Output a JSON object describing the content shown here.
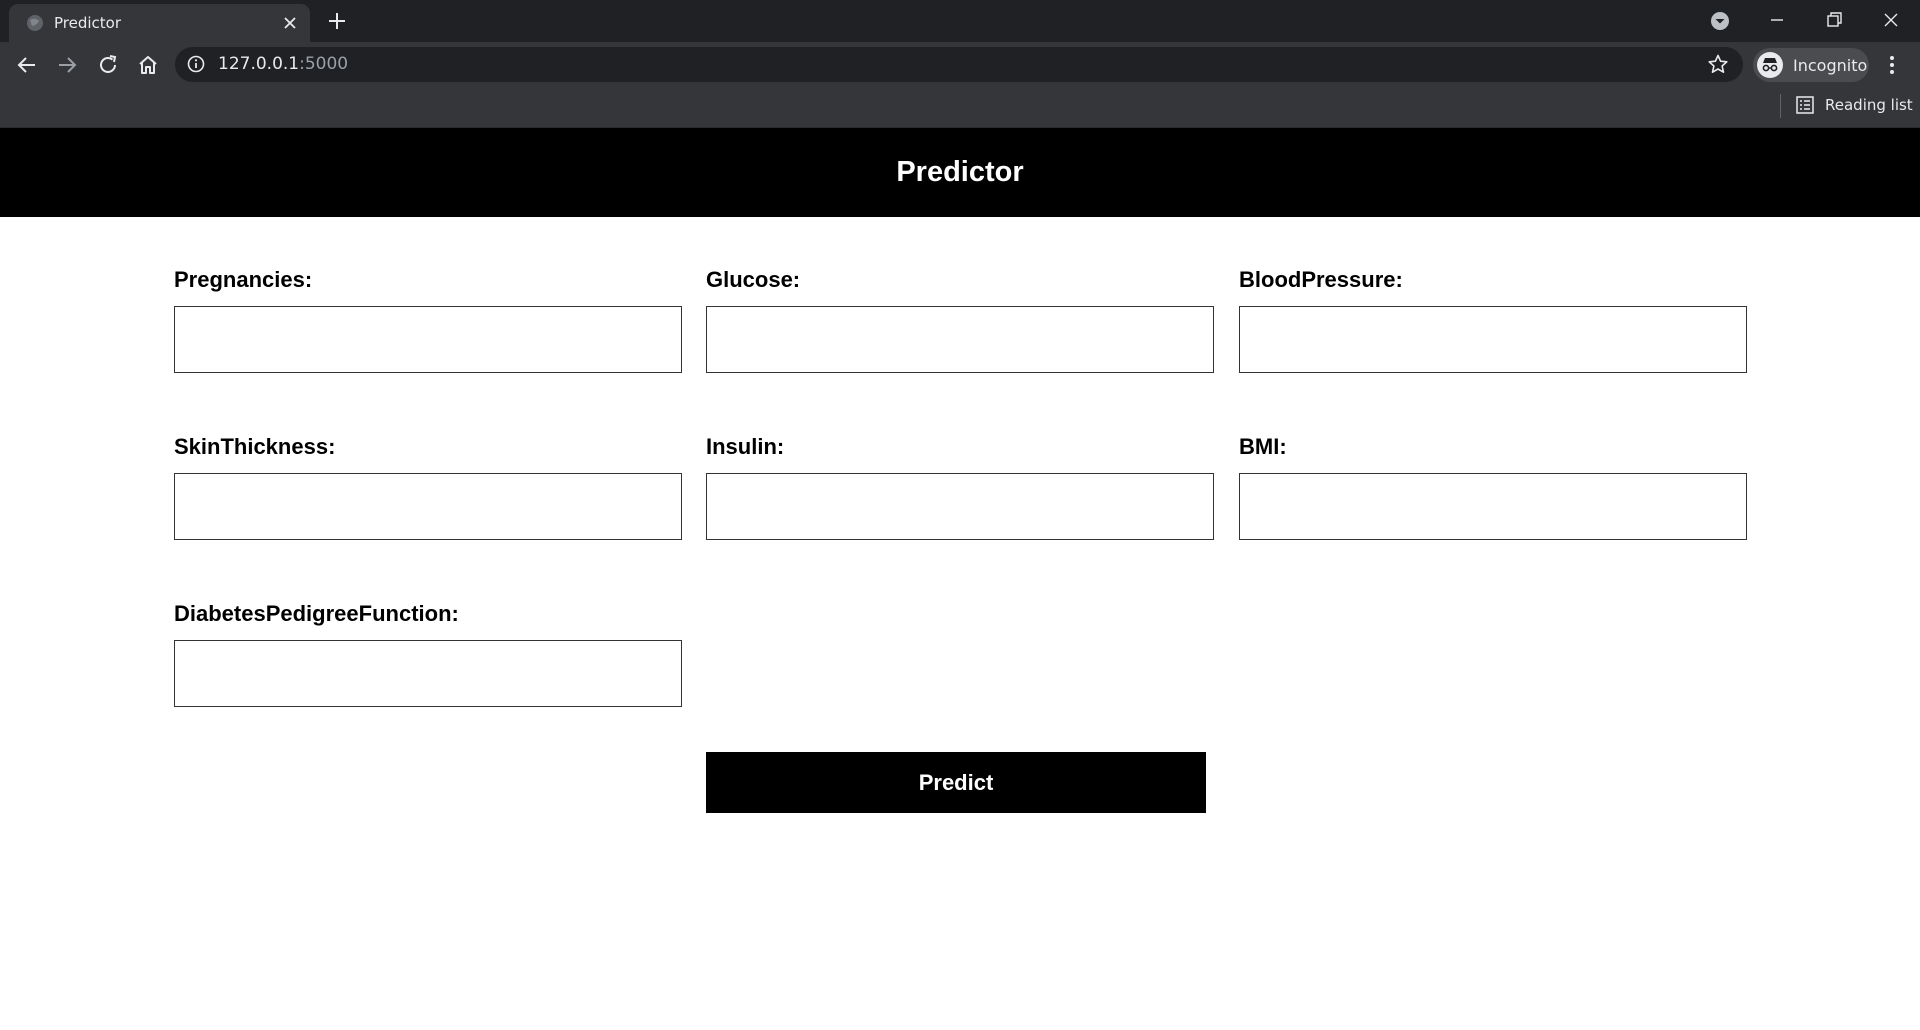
{
  "browser": {
    "tab_title": "Predictor",
    "url_host": "127.0.0.1",
    "url_port": ":5000",
    "profile_label": "Incognito",
    "reading_list_label": "Reading list"
  },
  "page": {
    "title": "Predictor",
    "fields": [
      {
        "label": "Pregnancies:",
        "value": ""
      },
      {
        "label": "Glucose:",
        "value": ""
      },
      {
        "label": "BloodPressure:",
        "value": ""
      },
      {
        "label": "SkinThickness:",
        "value": ""
      },
      {
        "label": "Insulin:",
        "value": ""
      },
      {
        "label": "BMI:",
        "value": ""
      },
      {
        "label": "DiabetesPedigreeFunction:",
        "value": ""
      }
    ],
    "submit_label": "Predict"
  },
  "colors": {
    "header_bg": "#000000",
    "button_bg": "#000000",
    "chrome_dark": "#202124",
    "chrome_toolbar": "#35363a"
  }
}
